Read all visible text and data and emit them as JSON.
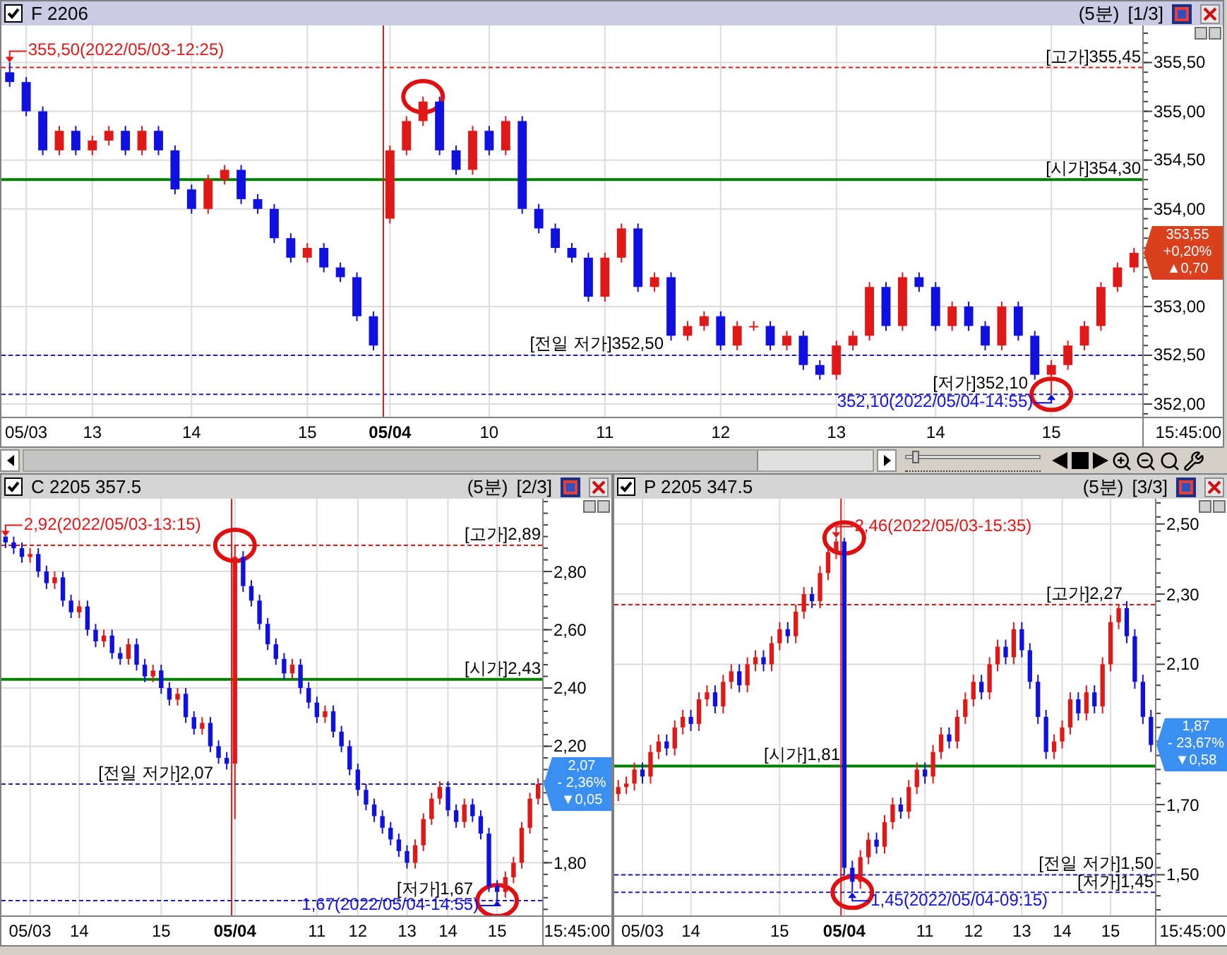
{
  "panels": [
    {
      "title": "F 2206",
      "period": "(5분)",
      "page": "[1/3]",
      "checked": true,
      "active": true,
      "axis_end_label": "15:45:00",
      "badge": {
        "price": "353,55",
        "change_pct": "+0,20%",
        "change": "▲0,70",
        "color": "#d9411e"
      },
      "chart_data": {
        "type": "candlestick",
        "ylim": [
          351.87,
          355.88
        ],
        "yticks": [
          {
            "value": 352,
            "label": "352,00"
          },
          {
            "value": 352.5,
            "label": "352,50"
          },
          {
            "value": 353,
            "label": "353,00"
          },
          {
            "value": 354,
            "label": "354,00"
          },
          {
            "value": 354.5,
            "label": "354,50"
          },
          {
            "value": 355,
            "label": "355,00"
          },
          {
            "value": 355.5,
            "label": "355,50"
          }
        ],
        "grid": true,
        "categories": [
          null,
          "05/03",
          null,
          null,
          null,
          "13",
          null,
          null,
          null,
          null,
          null,
          "14",
          null,
          null,
          null,
          null,
          null,
          null,
          "15",
          null,
          null,
          null,
          null,
          "05/04",
          null,
          null,
          null,
          null,
          null,
          "10",
          null,
          null,
          null,
          null,
          null,
          null,
          "11",
          null,
          null,
          null,
          null,
          null,
          null,
          "12",
          null,
          null,
          null,
          null,
          null,
          null,
          "13",
          null,
          null,
          null,
          null,
          null,
          "14",
          null,
          null,
          null,
          null,
          null,
          null,
          "15",
          null,
          null,
          null,
          null,
          null
        ],
        "ohlc": [
          [
            355.4,
            355.5,
            355.25,
            355.3
          ],
          [
            355.3,
            355.35,
            354.95,
            355.0
          ],
          [
            355.0,
            355.05,
            354.55,
            354.6
          ],
          [
            354.6,
            354.85,
            354.55,
            354.8
          ],
          [
            354.8,
            354.85,
            354.55,
            354.6
          ],
          [
            354.6,
            354.75,
            354.55,
            354.7
          ],
          [
            354.7,
            354.85,
            354.65,
            354.8
          ],
          [
            354.8,
            354.85,
            354.55,
            354.6
          ],
          [
            354.6,
            354.85,
            354.55,
            354.8
          ],
          [
            354.8,
            354.85,
            354.55,
            354.6
          ],
          [
            354.6,
            354.65,
            354.15,
            354.2
          ],
          [
            354.2,
            354.25,
            353.95,
            354.0
          ],
          [
            354.0,
            354.35,
            353.95,
            354.3
          ],
          [
            354.3,
            354.45,
            354.25,
            354.4
          ],
          [
            354.4,
            354.45,
            354.05,
            354.1
          ],
          [
            354.1,
            354.15,
            353.95,
            354.0
          ],
          [
            354.0,
            354.05,
            353.65,
            353.7
          ],
          [
            353.7,
            353.75,
            353.45,
            353.5
          ],
          [
            353.5,
            353.65,
            353.45,
            353.6
          ],
          [
            353.6,
            353.65,
            353.35,
            353.4
          ],
          [
            353.4,
            353.45,
            353.25,
            353.3
          ],
          [
            353.3,
            353.35,
            352.85,
            352.9
          ],
          [
            352.9,
            352.95,
            352.55,
            352.6
          ],
          [
            353.9,
            354.65,
            353.85,
            354.6
          ],
          [
            354.6,
            354.95,
            354.55,
            354.9
          ],
          [
            354.9,
            355.15,
            354.85,
            355.1
          ],
          [
            355.1,
            355.15,
            354.55,
            354.6
          ],
          [
            354.6,
            354.65,
            354.35,
            354.4
          ],
          [
            354.4,
            354.85,
            354.35,
            354.8
          ],
          [
            354.8,
            354.85,
            354.55,
            354.6
          ],
          [
            354.6,
            354.95,
            354.55,
            354.9
          ],
          [
            354.9,
            354.95,
            353.95,
            354.0
          ],
          [
            354.0,
            354.05,
            353.75,
            353.8
          ],
          [
            353.8,
            353.85,
            353.55,
            353.6
          ],
          [
            353.6,
            353.65,
            353.45,
            353.5
          ],
          [
            353.5,
            353.55,
            353.05,
            353.1
          ],
          [
            353.1,
            353.55,
            353.05,
            353.5
          ],
          [
            353.5,
            353.85,
            353.45,
            353.8
          ],
          [
            353.8,
            353.85,
            353.15,
            353.2
          ],
          [
            353.2,
            353.35,
            353.15,
            353.3
          ],
          [
            353.3,
            353.35,
            352.65,
            352.7
          ],
          [
            352.7,
            352.85,
            352.65,
            352.8
          ],
          [
            352.8,
            352.95,
            352.75,
            352.9
          ],
          [
            352.9,
            352.95,
            352.55,
            352.6
          ],
          [
            352.6,
            352.85,
            352.55,
            352.8
          ],
          [
            352.8,
            352.85,
            352.75,
            352.8
          ],
          [
            352.8,
            352.85,
            352.55,
            352.6
          ],
          [
            352.6,
            352.75,
            352.55,
            352.7
          ],
          [
            352.7,
            352.75,
            352.35,
            352.4
          ],
          [
            352.4,
            352.45,
            352.25,
            352.3
          ],
          [
            352.3,
            352.65,
            352.25,
            352.6
          ],
          [
            352.6,
            352.75,
            352.55,
            352.7
          ],
          [
            352.7,
            353.25,
            352.65,
            353.2
          ],
          [
            353.2,
            353.25,
            352.75,
            352.8
          ],
          [
            352.8,
            353.35,
            352.75,
            353.3
          ],
          [
            353.3,
            353.35,
            353.15,
            353.2
          ],
          [
            353.2,
            353.25,
            352.75,
            352.8
          ],
          [
            352.8,
            353.05,
            352.75,
            353.0
          ],
          [
            353.0,
            353.05,
            352.75,
            352.8
          ],
          [
            352.8,
            352.85,
            352.55,
            352.6
          ],
          [
            352.6,
            353.05,
            352.55,
            353.0
          ],
          [
            353.0,
            353.05,
            352.65,
            352.7
          ],
          [
            352.7,
            352.75,
            352.25,
            352.3
          ],
          [
            352.3,
            352.45,
            352.1,
            352.4
          ],
          [
            352.4,
            352.65,
            352.35,
            352.6
          ],
          [
            352.6,
            352.85,
            352.55,
            352.8
          ],
          [
            352.8,
            353.25,
            352.75,
            353.2
          ],
          [
            353.2,
            353.45,
            353.15,
            353.4
          ],
          [
            353.4,
            353.6,
            353.35,
            353.55
          ]
        ],
        "ref_lines": [
          {
            "axis": "y",
            "value": 355.45,
            "label": "[고가]355,45",
            "color": "#e01818"
          },
          {
            "axis": "y",
            "value": 354.3,
            "label": "[시가]354,30",
            "color": "#008000"
          },
          {
            "axis": "y",
            "value": 352.5,
            "label": "[전일 저가]352,50",
            "color": "#2020b0"
          },
          {
            "axis": "y",
            "value": 352.1,
            "label": "[저가]352,10",
            "color": "#2020b0"
          },
          {
            "axis": "x",
            "value": "05/04",
            "color": "#e01818"
          }
        ],
        "annotations": [
          "355,50(2022/05/03-12:25)",
          "352,10(2022/05/04-14:55)"
        ]
      }
    },
    {
      "title": "C 2205 357.5",
      "period": "(5분)",
      "page": "[2/3]",
      "checked": true,
      "active": false,
      "axis_end_label": "15:45:00",
      "badge": {
        "price": "2,07",
        "change_pct": "- 2,36%",
        "change": "▼0,05",
        "color": "#3b8ff0"
      },
      "chart_data": {
        "type": "candlestick",
        "ylim": [
          1.619,
          3.05
        ],
        "yticks": [
          {
            "value": 1.8,
            "label": "1,80"
          },
          {
            "value": 2.2,
            "label": "2,20"
          },
          {
            "value": 2.4,
            "label": "2,40"
          },
          {
            "value": 2.6,
            "label": "2,60"
          },
          {
            "value": 2.8,
            "label": "2,80"
          }
        ],
        "grid": true,
        "categories": [
          null,
          null,
          null,
          "05/03",
          null,
          null,
          null,
          null,
          null,
          "14",
          null,
          null,
          null,
          null,
          null,
          null,
          null,
          null,
          null,
          "15",
          null,
          null,
          null,
          null,
          null,
          null,
          null,
          null,
          "05/04",
          null,
          null,
          null,
          null,
          null,
          null,
          null,
          null,
          null,
          "11",
          null,
          null,
          null,
          null,
          "12",
          null,
          null,
          null,
          null,
          null,
          "13",
          null,
          null,
          null,
          null,
          "14",
          null,
          null,
          null,
          null,
          null,
          "15",
          null,
          null,
          null,
          null,
          null
        ],
        "ohlc": [
          [
            2.92,
            2.92,
            2.88,
            2.9
          ],
          [
            2.9,
            2.92,
            2.86,
            2.88
          ],
          [
            2.88,
            2.9,
            2.83,
            2.85
          ],
          [
            2.85,
            2.88,
            2.83,
            2.86
          ],
          [
            2.86,
            2.88,
            2.78,
            2.8
          ],
          [
            2.8,
            2.82,
            2.74,
            2.76
          ],
          [
            2.76,
            2.8,
            2.74,
            2.78
          ],
          [
            2.78,
            2.8,
            2.68,
            2.7
          ],
          [
            2.7,
            2.72,
            2.64,
            2.66
          ],
          [
            2.66,
            2.7,
            2.64,
            2.68
          ],
          [
            2.68,
            2.7,
            2.58,
            2.6
          ],
          [
            2.6,
            2.62,
            2.54,
            2.56
          ],
          [
            2.56,
            2.6,
            2.54,
            2.58
          ],
          [
            2.58,
            2.6,
            2.5,
            2.52
          ],
          [
            2.52,
            2.54,
            2.48,
            2.5
          ],
          [
            2.5,
            2.57,
            2.48,
            2.55
          ],
          [
            2.55,
            2.57,
            2.46,
            2.48
          ],
          [
            2.48,
            2.5,
            2.42,
            2.44
          ],
          [
            2.44,
            2.48,
            2.42,
            2.46
          ],
          [
            2.46,
            2.48,
            2.38,
            2.4
          ],
          [
            2.4,
            2.42,
            2.34,
            2.36
          ],
          [
            2.36,
            2.4,
            2.34,
            2.38
          ],
          [
            2.38,
            2.4,
            2.28,
            2.3
          ],
          [
            2.3,
            2.32,
            2.24,
            2.26
          ],
          [
            2.26,
            2.3,
            2.24,
            2.28
          ],
          [
            2.28,
            2.3,
            2.18,
            2.2
          ],
          [
            2.2,
            2.22,
            2.14,
            2.16
          ],
          [
            2.16,
            2.18,
            2.12,
            2.14
          ],
          [
            2.14,
            2.89,
            1.95,
            2.85
          ],
          [
            2.85,
            2.87,
            2.73,
            2.75
          ],
          [
            2.75,
            2.77,
            2.68,
            2.7
          ],
          [
            2.7,
            2.72,
            2.6,
            2.62
          ],
          [
            2.62,
            2.64,
            2.53,
            2.55
          ],
          [
            2.55,
            2.57,
            2.48,
            2.5
          ],
          [
            2.5,
            2.52,
            2.43,
            2.45
          ],
          [
            2.45,
            2.5,
            2.43,
            2.48
          ],
          [
            2.48,
            2.5,
            2.38,
            2.4
          ],
          [
            2.4,
            2.42,
            2.33,
            2.35
          ],
          [
            2.35,
            2.37,
            2.28,
            2.3
          ],
          [
            2.3,
            2.34,
            2.28,
            2.32
          ],
          [
            2.32,
            2.34,
            2.23,
            2.25
          ],
          [
            2.25,
            2.27,
            2.18,
            2.2
          ],
          [
            2.2,
            2.22,
            2.1,
            2.12
          ],
          [
            2.12,
            2.14,
            2.03,
            2.05
          ],
          [
            2.05,
            2.07,
            1.98,
            2.0
          ],
          [
            2.0,
            2.02,
            1.94,
            1.96
          ],
          [
            1.96,
            1.98,
            1.9,
            1.92
          ],
          [
            1.92,
            1.94,
            1.86,
            1.88
          ],
          [
            1.88,
            1.9,
            1.82,
            1.84
          ],
          [
            1.84,
            1.86,
            1.78,
            1.8
          ],
          [
            1.8,
            1.88,
            1.78,
            1.86
          ],
          [
            1.86,
            1.97,
            1.84,
            1.95
          ],
          [
            1.95,
            2.04,
            1.93,
            2.02
          ],
          [
            2.02,
            2.08,
            2.0,
            2.06
          ],
          [
            2.06,
            2.08,
            1.96,
            1.98
          ],
          [
            1.98,
            2.0,
            1.92,
            1.94
          ],
          [
            1.94,
            2.02,
            1.92,
            2.0
          ],
          [
            2.0,
            2.02,
            1.94,
            1.96
          ],
          [
            1.96,
            1.98,
            1.88,
            1.9
          ],
          [
            1.9,
            1.92,
            1.7,
            1.72
          ],
          [
            1.72,
            1.74,
            1.67,
            1.7
          ],
          [
            1.7,
            1.77,
            1.68,
            1.75
          ],
          [
            1.75,
            1.82,
            1.73,
            1.8
          ],
          [
            1.8,
            1.94,
            1.78,
            1.92
          ],
          [
            1.92,
            2.04,
            1.9,
            2.02
          ],
          [
            2.02,
            2.09,
            2.0,
            2.07
          ]
        ],
        "ref_lines": [
          {
            "axis": "y",
            "value": 2.89,
            "label": "[고가]2,89",
            "color": "#e01818"
          },
          {
            "axis": "y",
            "value": 2.43,
            "label": "[시가]2,43",
            "color": "#008000"
          },
          {
            "axis": "y",
            "value": 2.07,
            "label": "[전일 저가]2,07",
            "color": "#2020b0"
          },
          {
            "axis": "y",
            "value": 1.67,
            "label": "[저가]1,67",
            "color": "#2020b0"
          },
          {
            "axis": "x",
            "value": "05/04",
            "color": "#e01818"
          }
        ],
        "annotations": [
          "2,92(2022/05/03-13:15)",
          "1,67(2022/05/04-14:55)"
        ]
      }
    },
    {
      "title": "P 2205 347.5",
      "period": "(5분)",
      "page": "[3/3]",
      "checked": true,
      "active": false,
      "axis_end_label": "15:45:00",
      "badge": {
        "price": "1,87",
        "change_pct": "- 23,67%",
        "change": "▼0,58",
        "color": "#3b8ff0"
      },
      "chart_data": {
        "type": "candlestick",
        "ylim": [
          1.384,
          2.572
        ],
        "yticks": [
          {
            "value": 1.5,
            "label": "1,50"
          },
          {
            "value": 1.7,
            "label": "1,70"
          },
          {
            "value": 2.1,
            "label": "2,10"
          },
          {
            "value": 2.3,
            "label": "2,30"
          },
          {
            "value": 2.5,
            "label": "2,50"
          }
        ],
        "grid": true,
        "categories": [
          null,
          null,
          null,
          "05/03",
          null,
          null,
          null,
          null,
          null,
          "14",
          null,
          null,
          null,
          null,
          null,
          null,
          null,
          null,
          null,
          null,
          "15",
          null,
          null,
          null,
          null,
          null,
          null,
          null,
          "05/04",
          null,
          null,
          null,
          null,
          null,
          null,
          null,
          null,
          null,
          "11",
          null,
          null,
          null,
          null,
          null,
          "12",
          null,
          null,
          null,
          null,
          null,
          "13",
          null,
          null,
          null,
          null,
          "14",
          null,
          null,
          null,
          null,
          null,
          "15",
          null,
          null,
          null,
          null,
          null
        ],
        "ohlc": [
          [
            1.73,
            1.77,
            1.71,
            1.75
          ],
          [
            1.75,
            1.78,
            1.73,
            1.76
          ],
          [
            1.76,
            1.82,
            1.74,
            1.8
          ],
          [
            1.8,
            1.82,
            1.76,
            1.78
          ],
          [
            1.78,
            1.87,
            1.76,
            1.85
          ],
          [
            1.85,
            1.9,
            1.83,
            1.88
          ],
          [
            1.88,
            1.9,
            1.84,
            1.86
          ],
          [
            1.86,
            1.94,
            1.84,
            1.92
          ],
          [
            1.92,
            1.97,
            1.9,
            1.95
          ],
          [
            1.95,
            1.97,
            1.91,
            1.93
          ],
          [
            1.93,
            2.02,
            1.91,
            2.0
          ],
          [
            2.0,
            2.04,
            1.98,
            2.02
          ],
          [
            2.02,
            2.04,
            1.96,
            1.98
          ],
          [
            1.98,
            2.07,
            1.96,
            2.05
          ],
          [
            2.05,
            2.1,
            2.03,
            2.08
          ],
          [
            2.08,
            2.1,
            2.02,
            2.04
          ],
          [
            2.04,
            2.12,
            2.02,
            2.1
          ],
          [
            2.1,
            2.14,
            2.08,
            2.12
          ],
          [
            2.12,
            2.14,
            2.08,
            2.1
          ],
          [
            2.1,
            2.18,
            2.08,
            2.16
          ],
          [
            2.16,
            2.22,
            2.14,
            2.2
          ],
          [
            2.2,
            2.22,
            2.16,
            2.18
          ],
          [
            2.18,
            2.27,
            2.16,
            2.25
          ],
          [
            2.25,
            2.32,
            2.23,
            2.3
          ],
          [
            2.3,
            2.32,
            2.26,
            2.28
          ],
          [
            2.28,
            2.38,
            2.26,
            2.36
          ],
          [
            2.36,
            2.44,
            2.34,
            2.42
          ],
          [
            2.42,
            2.46,
            2.4,
            2.45
          ],
          [
            2.45,
            2.46,
            1.5,
            1.52
          ],
          [
            1.52,
            1.54,
            1.45,
            1.48
          ],
          [
            1.48,
            1.57,
            1.46,
            1.55
          ],
          [
            1.55,
            1.62,
            1.53,
            1.6
          ],
          [
            1.6,
            1.62,
            1.56,
            1.58
          ],
          [
            1.58,
            1.67,
            1.56,
            1.65
          ],
          [
            1.65,
            1.72,
            1.63,
            1.7
          ],
          [
            1.7,
            1.72,
            1.66,
            1.68
          ],
          [
            1.68,
            1.77,
            1.66,
            1.75
          ],
          [
            1.75,
            1.82,
            1.73,
            1.8
          ],
          [
            1.8,
            1.82,
            1.76,
            1.78
          ],
          [
            1.78,
            1.87,
            1.76,
            1.85
          ],
          [
            1.85,
            1.92,
            1.83,
            1.9
          ],
          [
            1.9,
            1.92,
            1.86,
            1.88
          ],
          [
            1.88,
            1.97,
            1.86,
            1.95
          ],
          [
            1.95,
            2.02,
            1.93,
            2.0
          ],
          [
            2.0,
            2.07,
            1.98,
            2.05
          ],
          [
            2.05,
            2.07,
            2.0,
            2.02
          ],
          [
            2.02,
            2.12,
            2.0,
            2.1
          ],
          [
            2.1,
            2.17,
            2.08,
            2.15
          ],
          [
            2.15,
            2.17,
            2.1,
            2.12
          ],
          [
            2.12,
            2.22,
            2.1,
            2.2
          ],
          [
            2.2,
            2.22,
            2.12,
            2.14
          ],
          [
            2.14,
            2.16,
            2.03,
            2.05
          ],
          [
            2.05,
            2.07,
            1.93,
            1.95
          ],
          [
            1.95,
            1.97,
            1.83,
            1.85
          ],
          [
            1.85,
            1.9,
            1.83,
            1.88
          ],
          [
            1.88,
            1.94,
            1.86,
            1.92
          ],
          [
            1.92,
            2.02,
            1.9,
            2.0
          ],
          [
            2.0,
            2.02,
            1.94,
            1.96
          ],
          [
            1.96,
            2.04,
            1.94,
            2.02
          ],
          [
            2.02,
            2.04,
            1.96,
            1.98
          ],
          [
            1.98,
            2.12,
            1.96,
            2.1
          ],
          [
            2.1,
            2.24,
            2.08,
            2.22
          ],
          [
            2.22,
            2.27,
            2.2,
            2.26
          ],
          [
            2.26,
            2.28,
            2.16,
            2.18
          ],
          [
            2.18,
            2.2,
            2.03,
            2.05
          ],
          [
            2.05,
            2.07,
            1.93,
            1.95
          ],
          [
            1.95,
            1.97,
            1.85,
            1.87
          ]
        ],
        "ref_lines": [
          {
            "axis": "y",
            "value": 2.27,
            "label": "[고가]2,27",
            "color": "#e01818"
          },
          {
            "axis": "y",
            "value": 1.81,
            "label": "[시가]1,81",
            "color": "#008000"
          },
          {
            "axis": "y",
            "value": 1.5,
            "label": "[전일 저가]1,50",
            "color": "#2020b0"
          },
          {
            "axis": "y",
            "value": 1.45,
            "label": "[저가]1,45",
            "color": "#2020b0"
          },
          {
            "axis": "x",
            "value": "05/04",
            "color": "#e01818"
          }
        ],
        "annotations": [
          "2,46(2022/05/03-15:35)",
          "1,45(2022/05/04-09:15)"
        ]
      }
    }
  ],
  "zoom_slider": {
    "level": 0.05
  }
}
